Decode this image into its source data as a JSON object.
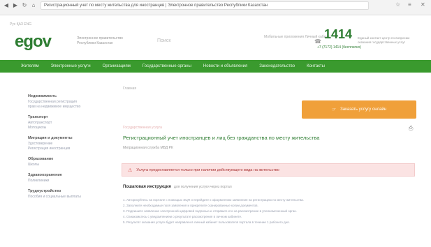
{
  "chrome": {
    "url": "Регистрационный учет по месту жительства для иностранцев | Электронное правительство Республики Казахстан",
    "lang": "Рус  ҚАЗ  ENG"
  },
  "header": {
    "logo_e": "e",
    "logo_g": "gov",
    "tagline": "Электронное правительство Республики Казахстан",
    "search_placeholder": "Поиск",
    "phone": "1414",
    "phone_sub": "+7 (7172) 1414 (бесплатно)",
    "phone_note": "Единый контакт-центр по вопросам оказания государственных услуг",
    "top_links": "Мобильные приложения  Личный кабинет"
  },
  "nav": [
    "Жителям",
    "Электронные услуги",
    "Организациям",
    "Государственные органы",
    "Новости и объявления",
    "Законодательство",
    "Контакты"
  ],
  "sidebar": [
    {
      "title": "Недвижимость",
      "links": [
        "Государственная регистрация",
        "прав на недвижимое имущество"
      ]
    },
    {
      "title": "Транспорт",
      "links": [
        "Автотранспорт",
        "Мотоциклы"
      ]
    },
    {
      "title": "Миграция и документы",
      "links": [
        "Удостоверение",
        "Регистрация иностранцев"
      ]
    },
    {
      "title": "Образование",
      "links": [
        "Школы"
      ]
    },
    {
      "title": "Здравоохранение",
      "links": [
        "Поликлиники"
      ]
    },
    {
      "title": "Трудоустройство",
      "links": [
        "Пособия и социальные выплаты"
      ]
    }
  ],
  "main": {
    "breadcrumb": "Главная",
    "cta": "Заказать услугу онлайн",
    "kicker": "Государственная услуга",
    "title": "Регистрационный учет иностранцев и лиц без гражданства по месту жительства",
    "subtitle": "Миграционная служба МВД РК",
    "alert": "Услуга предоставляется только при наличии действующего вида на жительство",
    "section_heading": "Пошаговая инструкция",
    "section_note": "для получения услуги через портал",
    "body_lines": [
      "1. Авторизуйтесь на портале с помощью ЭЦП и перейдите к оформлению заявления на регистрацию по месту жительства.",
      "2. Заполните необходимые поля заявления и прикрепите сканированные копии документов.",
      "3. Подпишите заявление электронной цифровой подписью и отправьте его на рассмотрение в уполномоченный орган.",
      "4. Ознакомьтесь с уведомлением о результате рассмотрения в личном кабинете.",
      "5. Результат оказания услуги будет направлен в личный кабинет пользователя портала в течение 1 рабочего дня."
    ]
  },
  "colors": {
    "brand_green": "#3a9a2e",
    "cta_orange": "#f0a03a",
    "alert_bg": "#fbe3e3"
  }
}
